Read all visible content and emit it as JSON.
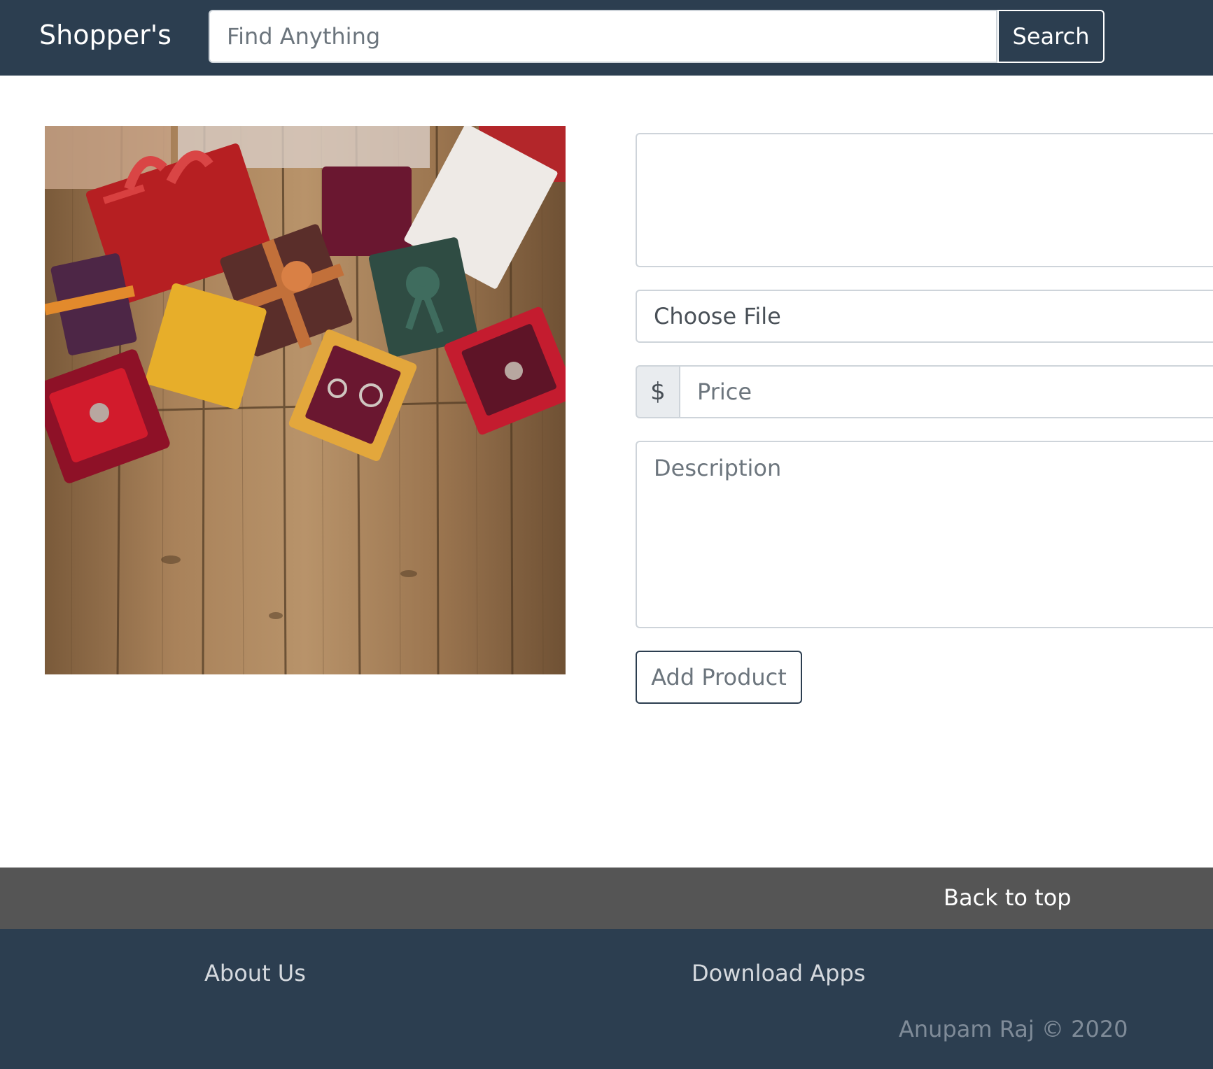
{
  "navbar": {
    "brand": "Shopper's",
    "search_placeholder": "Find Anything",
    "search_button": "Search",
    "background_color": "#2c3e50"
  },
  "product_form": {
    "image_description": "Gift boxes and jewelry on wooden floor",
    "name_value": "",
    "file_label": "Choose File",
    "price_prefix": "$",
    "price_placeholder": "Price",
    "description_placeholder": "Description",
    "submit_label": "Add Product"
  },
  "back_to_top": {
    "label": "Back to top",
    "background_color": "#555555"
  },
  "footer": {
    "about_label": "About Us",
    "apps_label": "Download Apps",
    "copyright": "Anupam Raj © 2020",
    "background_color": "#2c3e50"
  }
}
